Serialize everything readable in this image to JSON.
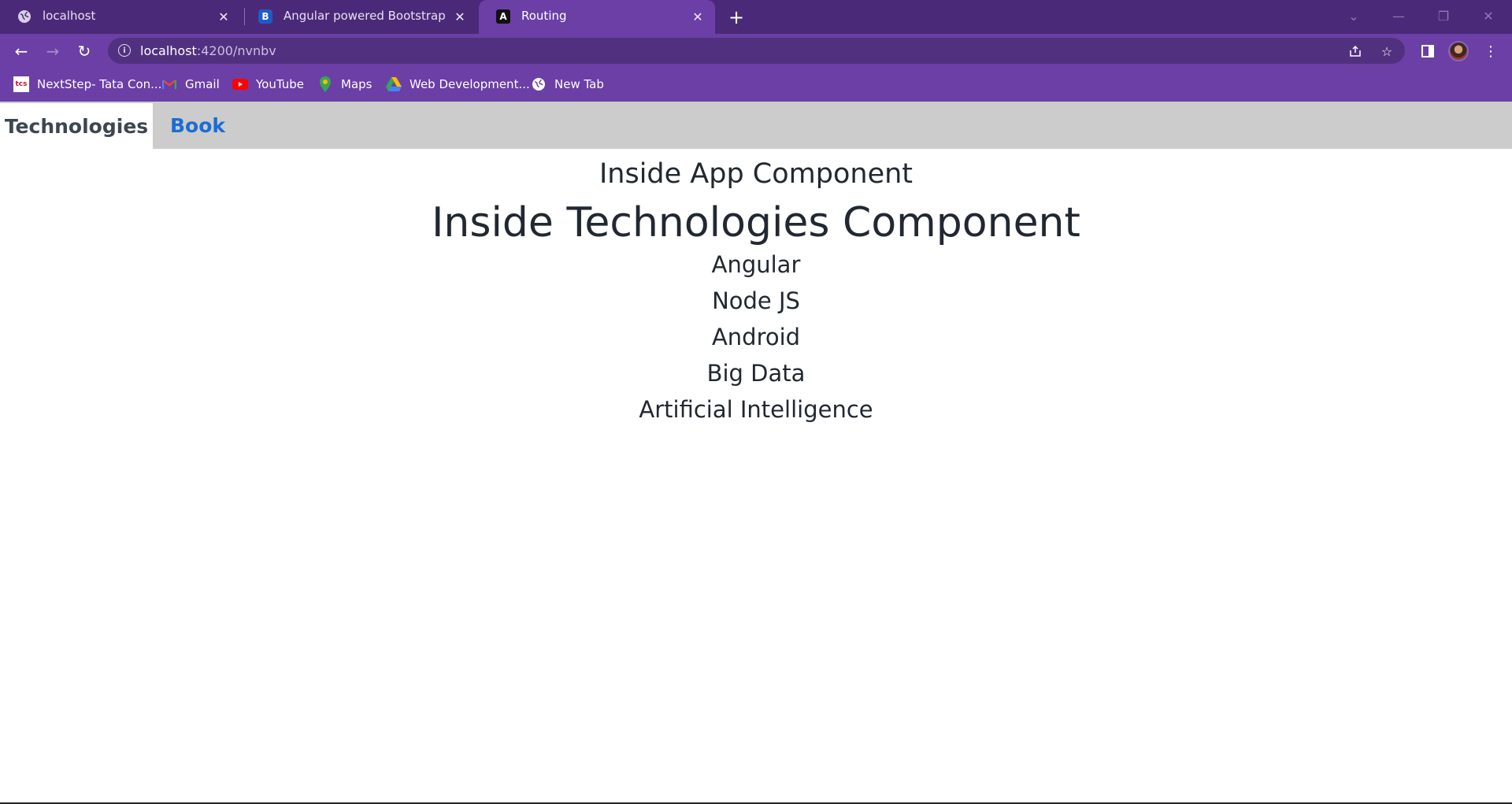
{
  "browser": {
    "tabs": [
      {
        "title": "localhost",
        "icon": "globe-icon",
        "active": false
      },
      {
        "title": "Angular powered Bootstrap",
        "icon": "bootstrap-icon",
        "active": false
      },
      {
        "title": "Routing",
        "icon": "angular-icon",
        "active": true
      }
    ],
    "new_tab_symbol": "+",
    "url_host": "localhost",
    "url_path": ":4200/nvnbv",
    "bookmarks": [
      {
        "label": "NextStep- Tata Con...",
        "icon": "tcs-icon"
      },
      {
        "label": "Gmail",
        "icon": "gmail-icon"
      },
      {
        "label": "YouTube",
        "icon": "youtube-icon"
      },
      {
        "label": "Maps",
        "icon": "maps-icon"
      },
      {
        "label": "Web Development...",
        "icon": "drive-icon"
      },
      {
        "label": "New Tab",
        "icon": "globe-icon"
      }
    ]
  },
  "page": {
    "nav": {
      "active_label": "Technologies",
      "link_label": "Book"
    },
    "app_heading": "Inside App Component",
    "technologies_heading": "Inside Technologies Component",
    "technologies": [
      "Angular",
      "Node JS",
      "Android",
      "Big Data",
      "Artificial Intelligence"
    ]
  },
  "colors": {
    "tabstrip": "#4a2a78",
    "toolbar": "#6b3fa6",
    "navbar": "#cccccc",
    "link": "#1a6dd6",
    "text": "#222831"
  }
}
